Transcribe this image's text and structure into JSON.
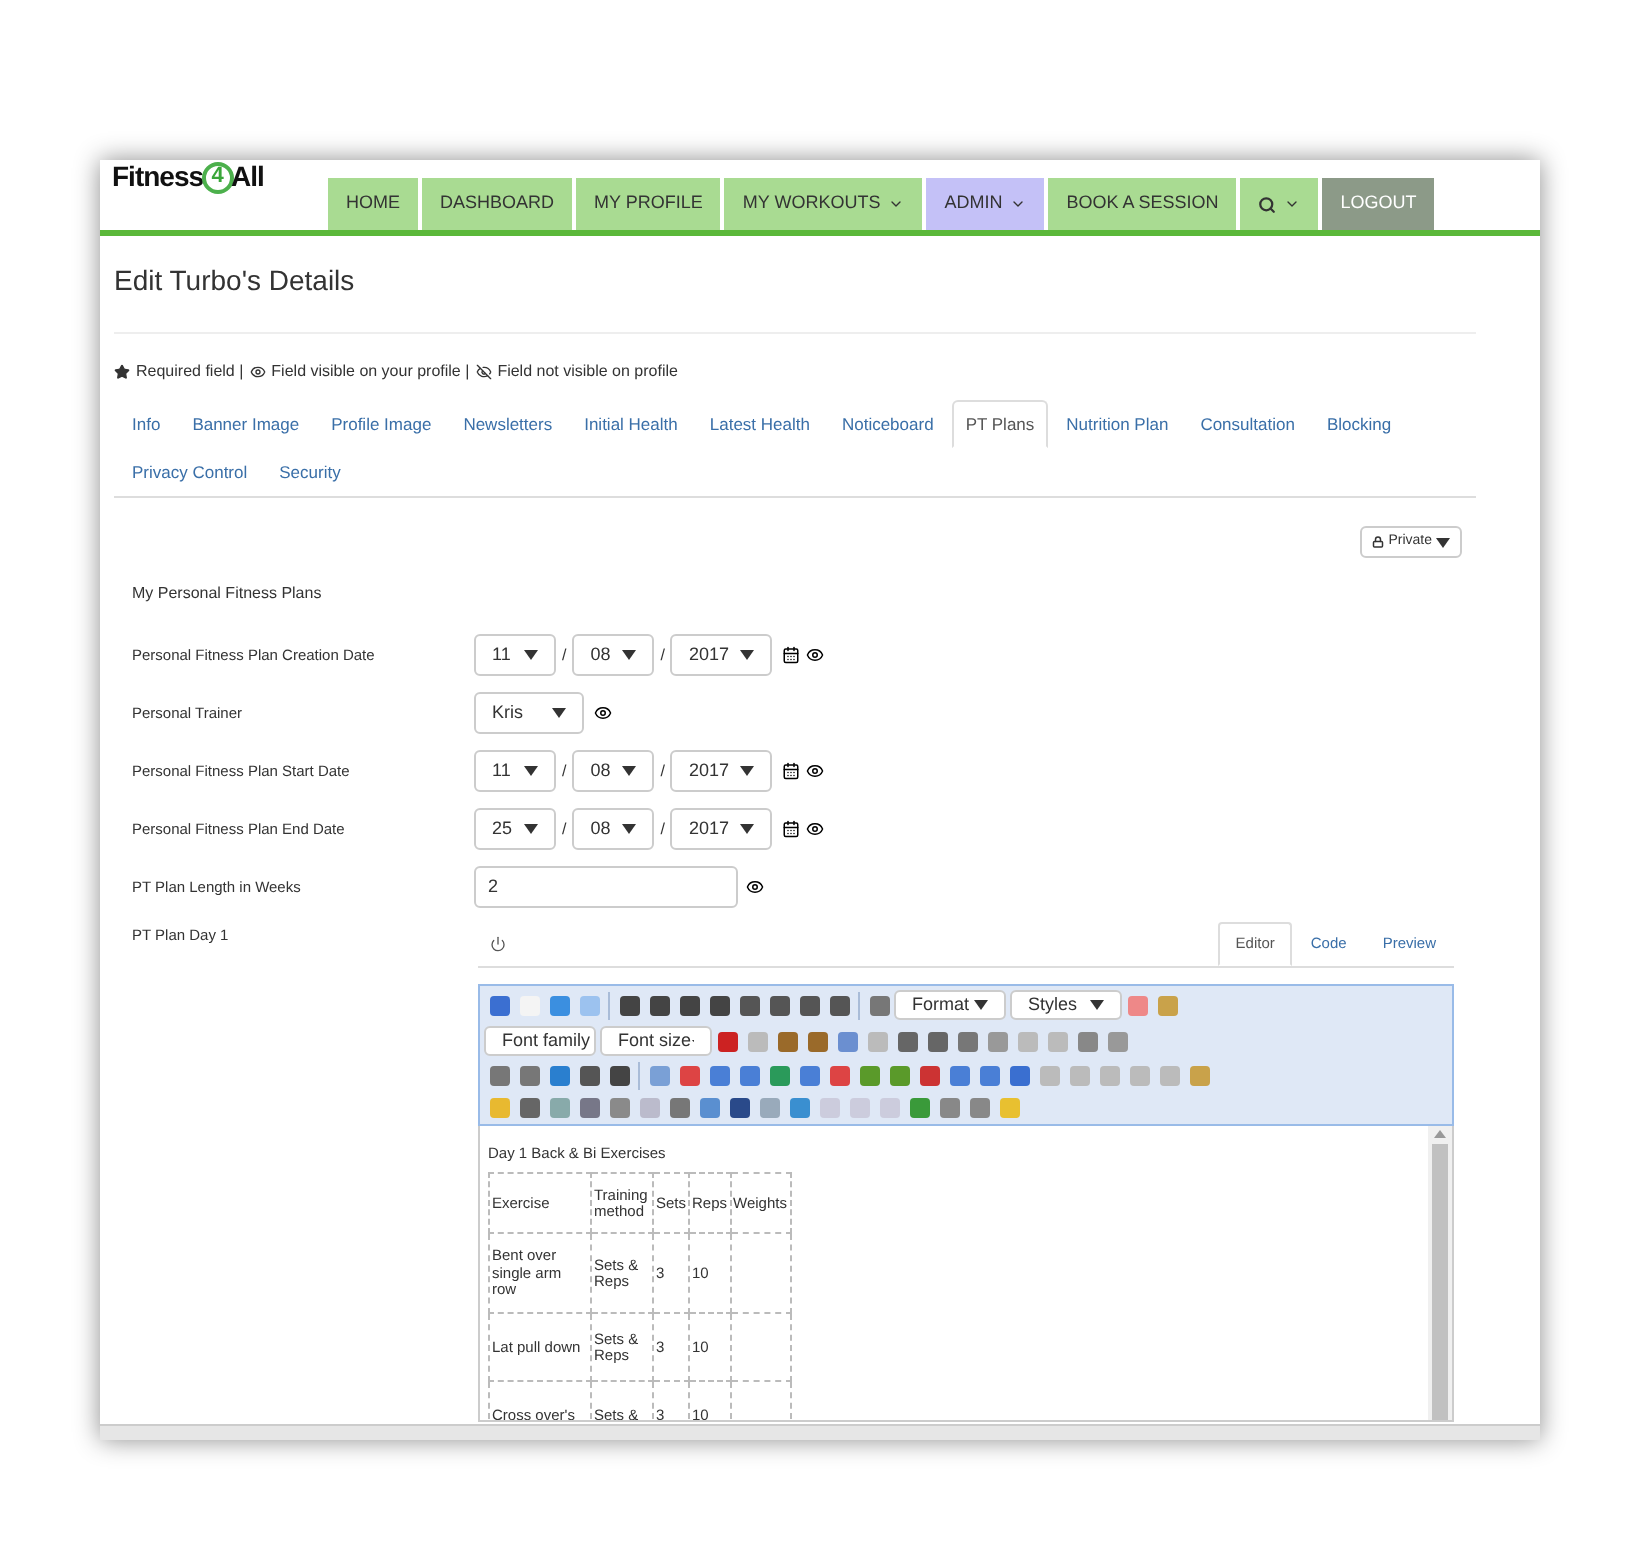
{
  "logo": {
    "left": "Fitness",
    "mark": "4",
    "right": "All"
  },
  "nav": [
    {
      "label": "HOME",
      "kind": "link",
      "color": "#a9db92"
    },
    {
      "label": "DASHBOARD",
      "kind": "link",
      "color": "#a9db92"
    },
    {
      "label": "MY PROFILE",
      "kind": "link",
      "color": "#a9db92"
    },
    {
      "label": "MY WORKOUTS",
      "kind": "dropdown",
      "color": "#a9db92"
    },
    {
      "label": "ADMIN",
      "kind": "dropdown",
      "color": "#c4c1f7"
    },
    {
      "label": "BOOK A SESSION",
      "kind": "link",
      "color": "#a9db92"
    },
    {
      "kind": "search",
      "color": "#a9db92"
    },
    {
      "label": "LOGOUT",
      "kind": "link",
      "color": "#8c9a88"
    }
  ],
  "page_title": "Edit Turbo's Details",
  "legend": [
    {
      "kind": "star",
      "text": "Required field |"
    },
    {
      "kind": "eye",
      "text": "Field visible on your profile |"
    },
    {
      "kind": "eye-off",
      "text": "Field not visible on profile"
    }
  ],
  "tabs": [
    {
      "label": "Info",
      "selected": false
    },
    {
      "label": "Banner Image",
      "selected": false
    },
    {
      "label": "Profile Image",
      "selected": false
    },
    {
      "label": "Newsletters",
      "selected": false
    },
    {
      "label": "Initial Health",
      "selected": false
    },
    {
      "label": "Latest Health",
      "selected": false
    },
    {
      "label": "Noticeboard",
      "selected": false
    },
    {
      "label": "PT Plans",
      "selected": true
    },
    {
      "label": "Nutrition Plan",
      "selected": false
    },
    {
      "label": "Consultation",
      "selected": false
    },
    {
      "label": "Blocking",
      "selected": false
    },
    {
      "label": "Privacy Control",
      "selected": false
    },
    {
      "label": "Security",
      "selected": false
    }
  ],
  "privacy_button": "Private",
  "section_title": "My Personal Fitness Plans",
  "fields": [
    {
      "label": "Personal Fitness Plan Creation Date",
      "kind": "date",
      "separator": "/",
      "parts": [
        "11",
        "08",
        "2017"
      ]
    },
    {
      "label": "Personal Trainer",
      "kind": "select",
      "value": "Kris"
    },
    {
      "label": "Personal Fitness Plan Start Date",
      "kind": "date",
      "separator": "/",
      "parts": [
        "11",
        "08",
        "2017"
      ]
    },
    {
      "label": "Personal Fitness Plan End Date",
      "kind": "date",
      "separator": "/",
      "parts": [
        "25",
        "08",
        "2017"
      ]
    },
    {
      "label": "PT Plan Length in Weeks",
      "kind": "text",
      "value": "2"
    }
  ],
  "editor": {
    "label": "PT Plan Day 1",
    "tabs": [
      {
        "label": "Editor",
        "selected": true
      },
      {
        "label": "Code",
        "selected": false
      },
      {
        "label": "Preview",
        "selected": false
      }
    ],
    "format_select": "Format",
    "styles_select": "Styles",
    "font_family": "Font family",
    "font_size": "Font size",
    "heading": "Day 1 Back & Bi Exercises",
    "columns": [
      "Exercise",
      "Training method",
      "Sets",
      "Reps",
      "Weights"
    ],
    "rows": [
      [
        "Bent over single arm row",
        "Sets & Reps",
        "3",
        "10"
      ],
      [
        "Lat pull down",
        "Sets & Reps",
        "3",
        "10"
      ],
      [
        "Cross over's",
        "Sets &",
        "3",
        "10"
      ]
    ]
  }
}
